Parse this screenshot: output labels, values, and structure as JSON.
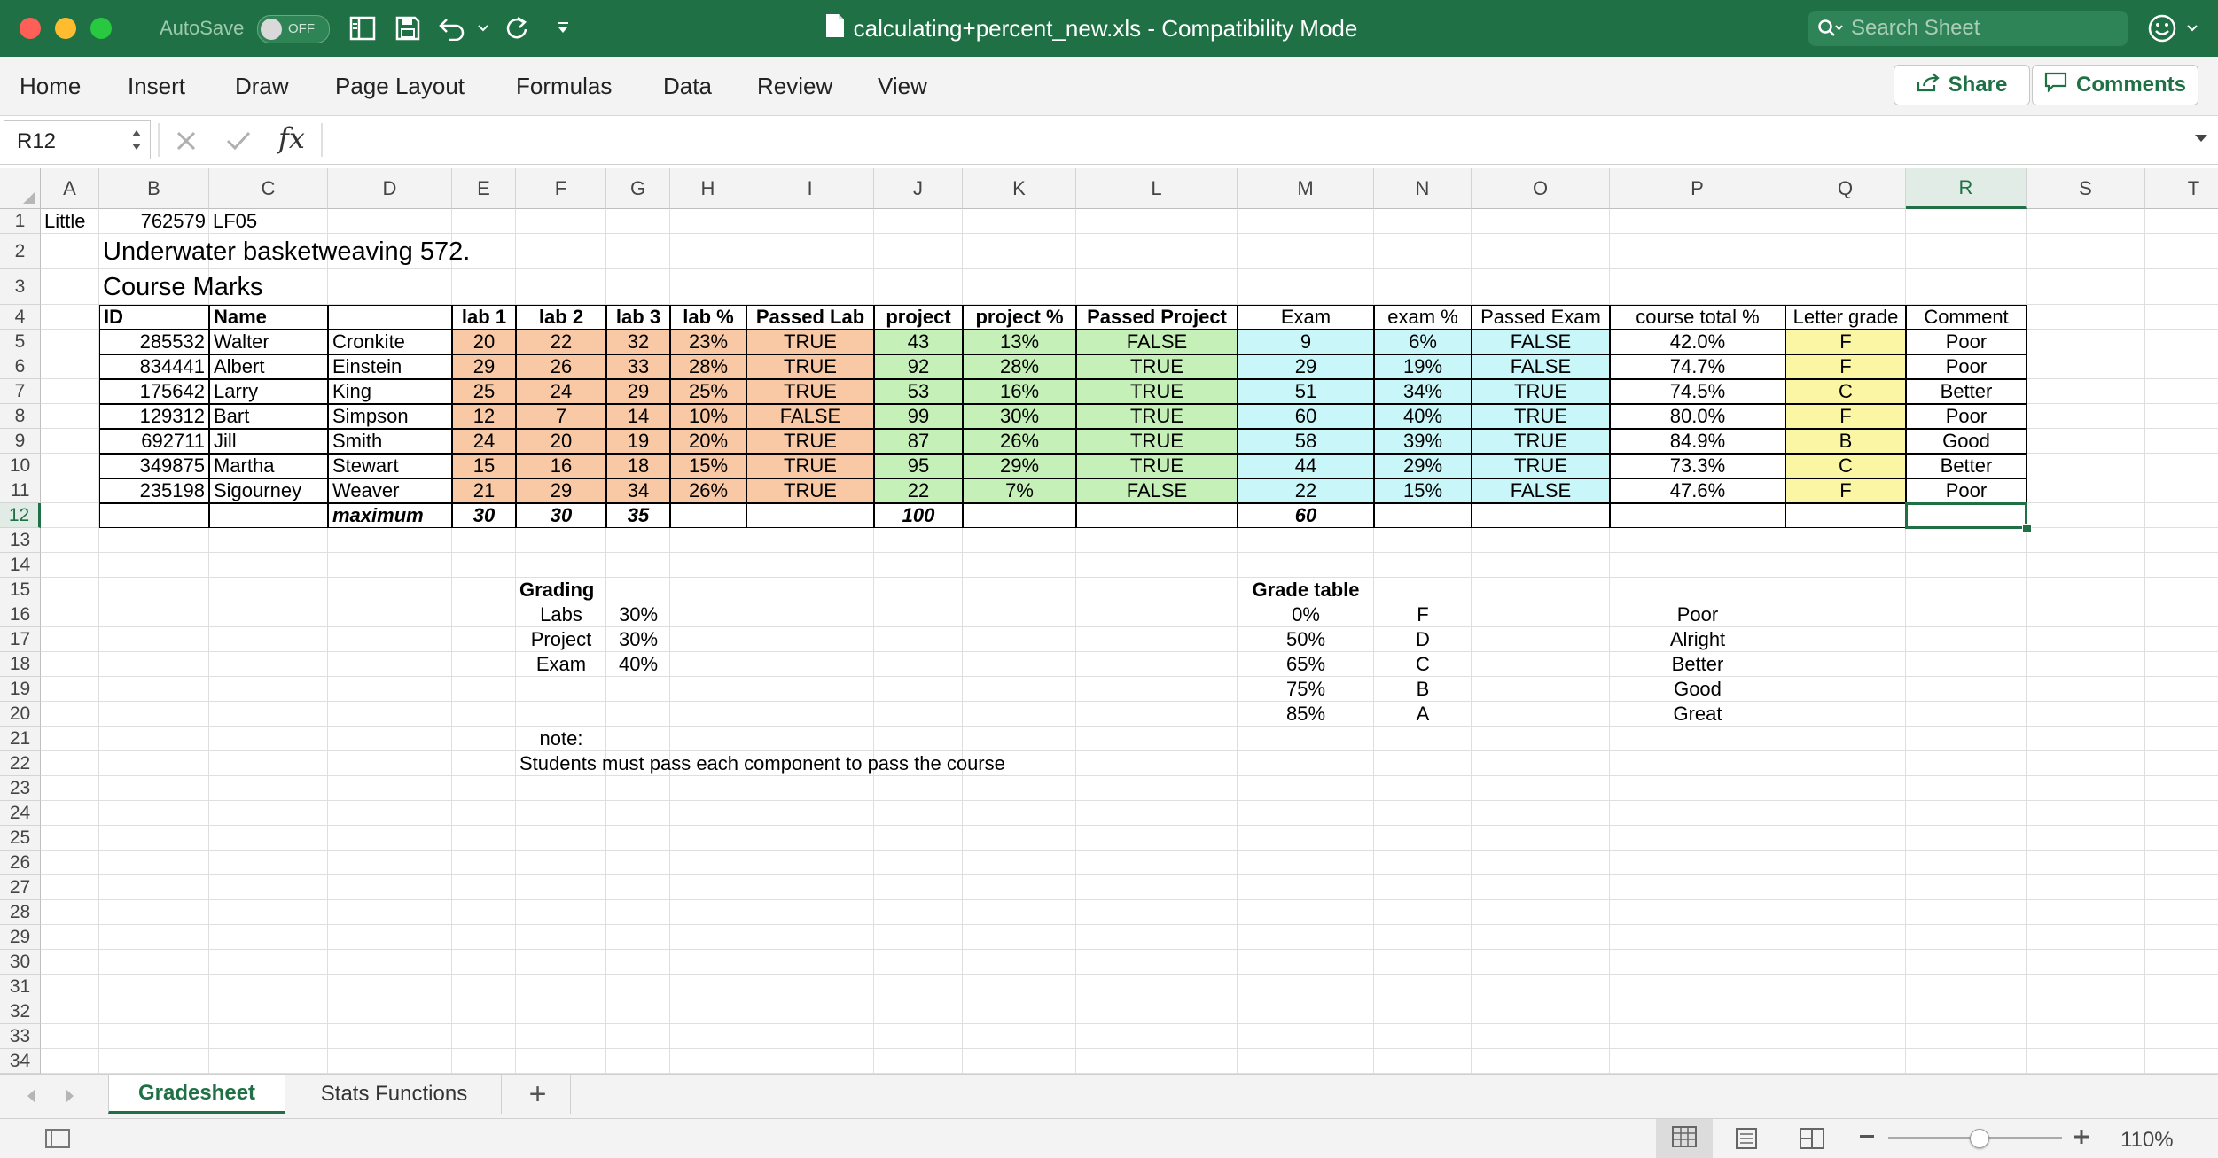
{
  "window": {
    "autosave_label": "AutoSave",
    "autosave_state": "OFF",
    "title": "calculating+percent_new.xls  -  Compatibility Mode",
    "search_placeholder": "Search Sheet"
  },
  "ribbon": {
    "tabs": [
      "Home",
      "Insert",
      "Draw",
      "Page Layout",
      "Formulas",
      "Data",
      "Review",
      "View"
    ],
    "share_label": "Share",
    "comments_label": "Comments"
  },
  "formula_bar": {
    "name_box": "R12",
    "fx": "fx",
    "formula": ""
  },
  "columns": [
    "A",
    "B",
    "C",
    "D",
    "E",
    "F",
    "G",
    "H",
    "I",
    "J",
    "K",
    "L",
    "M",
    "N",
    "O",
    "P",
    "Q",
    "R",
    "S",
    "T"
  ],
  "rows": [
    "1",
    "2",
    "3",
    "4",
    "5",
    "6",
    "7",
    "8",
    "9",
    "10",
    "11",
    "12",
    "13",
    "14",
    "15",
    "16",
    "17",
    "18",
    "19",
    "20",
    "21",
    "22",
    "23",
    "24",
    "25",
    "26",
    "27",
    "28",
    "29",
    "30",
    "31",
    "32",
    "33",
    "34"
  ],
  "selected": {
    "col": "R",
    "row": "12"
  },
  "sheet": {
    "r1": {
      "a": "Little",
      "b": "762579",
      "c": "LF05"
    },
    "title": "Underwater basketweaving 572.",
    "subtitle": "Course Marks",
    "headers": [
      "ID",
      "Name",
      "",
      "lab 1",
      "lab 2",
      "lab 3",
      "lab %",
      "Passed Lab",
      "project",
      "project %",
      "Passed Project",
      "Exam",
      "exam %",
      "Passed Exam",
      "course total %",
      "Letter grade",
      "Comment"
    ],
    "students": [
      [
        "285532",
        "Walter",
        "Cronkite",
        "20",
        "22",
        "32",
        "23%",
        "TRUE",
        "43",
        "13%",
        "FALSE",
        "9",
        "6%",
        "FALSE",
        "42.0%",
        "F",
        "Poor"
      ],
      [
        "834441",
        "Albert",
        "Einstein",
        "29",
        "26",
        "33",
        "28%",
        "TRUE",
        "92",
        "28%",
        "TRUE",
        "29",
        "19%",
        "FALSE",
        "74.7%",
        "F",
        "Poor"
      ],
      [
        "175642",
        "Larry",
        "King",
        "25",
        "24",
        "29",
        "25%",
        "TRUE",
        "53",
        "16%",
        "TRUE",
        "51",
        "34%",
        "TRUE",
        "74.5%",
        "C",
        "Better"
      ],
      [
        "129312",
        "Bart",
        "Simpson",
        "12",
        "7",
        "14",
        "10%",
        "FALSE",
        "99",
        "30%",
        "TRUE",
        "60",
        "40%",
        "TRUE",
        "80.0%",
        "F",
        "Poor"
      ],
      [
        "692711",
        "Jill",
        "Smith",
        "24",
        "20",
        "19",
        "20%",
        "TRUE",
        "87",
        "26%",
        "TRUE",
        "58",
        "39%",
        "TRUE",
        "84.9%",
        "B",
        "Good"
      ],
      [
        "349875",
        "Martha",
        "Stewart",
        "15",
        "16",
        "18",
        "15%",
        "TRUE",
        "95",
        "29%",
        "TRUE",
        "44",
        "29%",
        "TRUE",
        "73.3%",
        "C",
        "Better"
      ],
      [
        "235198",
        "Sigourney",
        "Weaver",
        "21",
        "29",
        "34",
        "26%",
        "TRUE",
        "22",
        "7%",
        "FALSE",
        "22",
        "15%",
        "FALSE",
        "47.6%",
        "F",
        "Poor"
      ]
    ],
    "maximum_row": {
      "label": "maximum",
      "lab1": "30",
      "lab2": "30",
      "lab3": "35",
      "project": "100",
      "exam": "60"
    },
    "grading": {
      "title": "Grading",
      "items": [
        {
          "name": "Labs",
          "weight": "30%"
        },
        {
          "name": "Project",
          "weight": "30%"
        },
        {
          "name": "Exam",
          "weight": "40%"
        }
      ],
      "note_label": "note:",
      "note": "Students must pass each component to pass the course"
    },
    "grade_table": {
      "title": "Grade table",
      "rows": [
        {
          "min": "0%",
          "letter": "F",
          "comment": "Poor"
        },
        {
          "min": "50%",
          "letter": "D",
          "comment": "Alright"
        },
        {
          "min": "65%",
          "letter": "C",
          "comment": "Better"
        },
        {
          "min": "75%",
          "letter": "B",
          "comment": "Good"
        },
        {
          "min": "85%",
          "letter": "A",
          "comment": "Great"
        }
      ]
    }
  },
  "sheet_tabs": [
    "Gradesheet",
    "Stats Functions"
  ],
  "active_sheet": "Gradesheet",
  "add_sheet": "+",
  "status": {
    "zoom": "110%",
    "zoom_level": 0.52
  },
  "colors": {
    "accent": "#1f7145",
    "lab_fill": "#f9c8a4",
    "project_fill": "#c5f0b8",
    "exam_fill": "#c9f6f8",
    "grade_fill": "#fbf6a4"
  }
}
